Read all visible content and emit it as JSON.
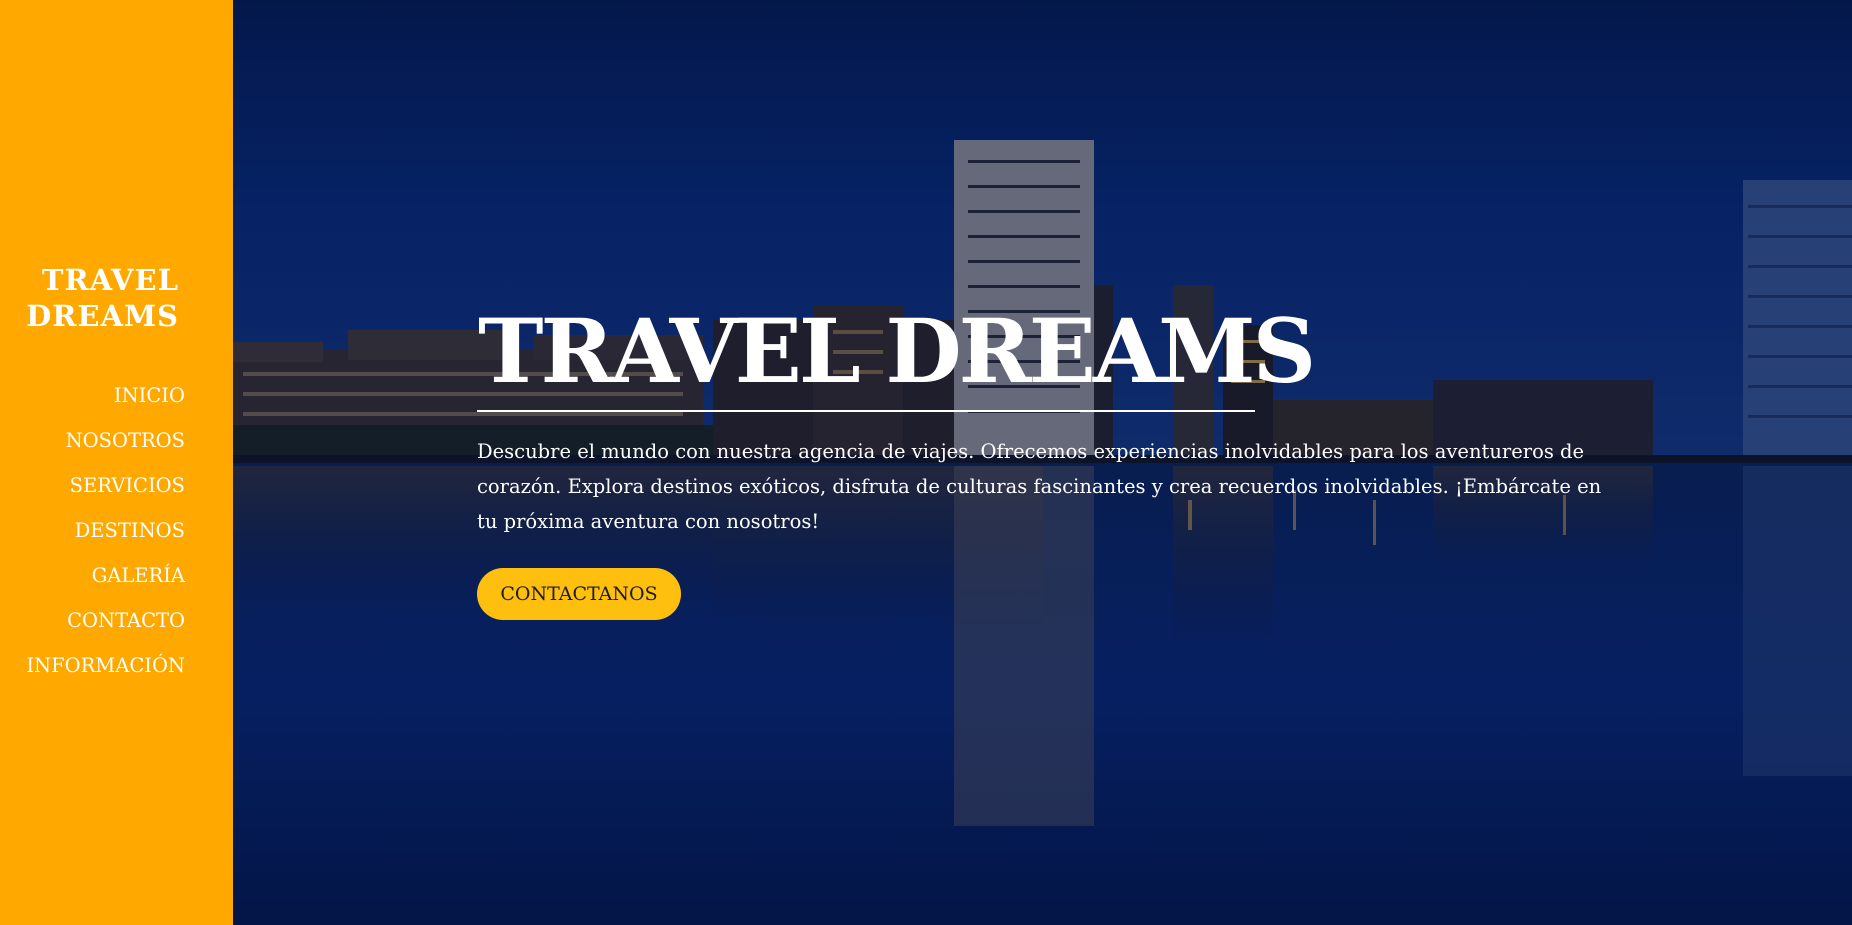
{
  "sidebar": {
    "brand_line1": "TRAVEL",
    "brand_line2": "DREAMS",
    "items": [
      {
        "label": "INICIO"
      },
      {
        "label": "NOSOTROS"
      },
      {
        "label": "SERVICIOS"
      },
      {
        "label": "DESTINOS"
      },
      {
        "label": "GALERÍA"
      },
      {
        "label": "CONTACTO"
      },
      {
        "label": "INFORMACIÓN"
      }
    ]
  },
  "hero": {
    "title": "TRAVEL DREAMS",
    "description": "Descubre el mundo con nuestra agencia de viajes. Ofrecemos experiencias inolvidables para los aventureros de corazón. Explora destinos exóticos, disfruta de culturas fascinantes y crea recuerdos inolvidables. ¡Embárcate en tu próxima aventura con nosotros!",
    "cta_label": "CONTACTANOS"
  },
  "colors": {
    "sidebar_bg": "#ffa800",
    "button_bg": "#ffbf0f",
    "hero_bg": "#0a2a6e"
  }
}
